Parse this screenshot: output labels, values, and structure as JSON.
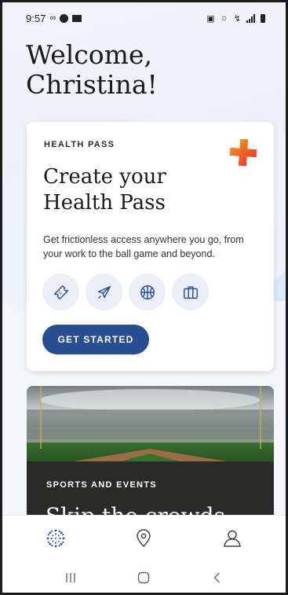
{
  "status_bar": {
    "time": "9:57",
    "left_icons": [
      "voicemail-icon",
      "messenger-icon",
      "mail-icon"
    ],
    "right_icons": [
      "lock-icon",
      "alarm-icon",
      "wifi-calling-icon",
      "signal-icon",
      "battery-icon"
    ]
  },
  "greeting": {
    "line1": "Welcome,",
    "line2": "Christina!"
  },
  "health_pass_card": {
    "eyebrow": "HEALTH PASS",
    "title_line1": "Create your",
    "title_line2": "Health Pass",
    "description": "Get frictionless access anywhere you go, from your work to the ball game and beyond.",
    "icons": [
      "ticket-icon",
      "airplane-icon",
      "basketball-icon",
      "briefcase-icon"
    ],
    "cta_label": "GET STARTED",
    "accent_color": "#274f91",
    "plus_colors": [
      "#f4a324",
      "#e8262b"
    ]
  },
  "sports_card": {
    "eyebrow": "SPORTS AND EVENTS",
    "title": "Skip the crowds"
  },
  "bottom_nav": {
    "items": [
      "home-icon",
      "location-pin-icon",
      "profile-icon"
    ]
  },
  "system_nav": {
    "items": [
      "recents-icon",
      "home-button-icon",
      "back-icon"
    ]
  }
}
